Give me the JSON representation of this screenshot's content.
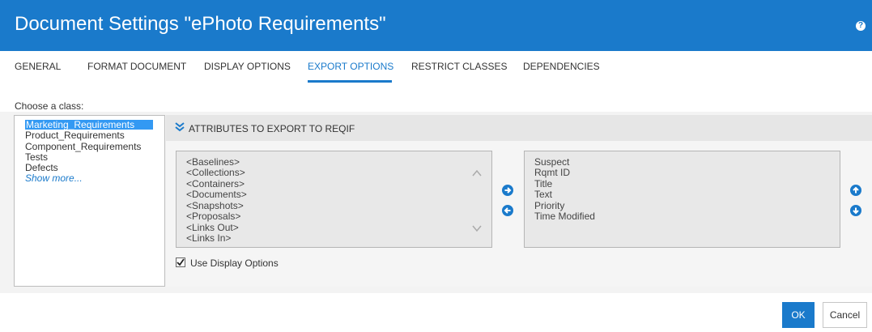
{
  "header": {
    "title": "Document Settings \"ePhoto Requirements\"",
    "help_icon": "question-circle-icon",
    "help_glyph": "?"
  },
  "tabs": [
    {
      "label": "GENERAL"
    },
    {
      "label": "FORMAT DOCUMENT"
    },
    {
      "label": "DISPLAY OPTIONS"
    },
    {
      "label": "EXPORT OPTIONS",
      "active": true
    },
    {
      "label": "RESTRICT CLASSES"
    },
    {
      "label": "DEPENDENCIES"
    }
  ],
  "class_panel": {
    "label": "Choose a class:",
    "items": [
      {
        "label": "Marketing_Requirements",
        "selected": true
      },
      {
        "label": "Product_Requirements"
      },
      {
        "label": "Component_Requirements"
      },
      {
        "label": "Tests"
      },
      {
        "label": "Defects"
      }
    ],
    "show_more": "Show more..."
  },
  "attributes": {
    "header": "ATTRIBUTES TO EXPORT TO REQIF",
    "available": [
      "<Baselines>",
      "<Collections>",
      "<Containers>",
      "<Documents>",
      "<Snapshots>",
      "<Proposals>",
      "<Links Out>",
      "<Links In>"
    ],
    "selected": [
      "Suspect",
      "Rqmt ID",
      "Title",
      "Text",
      "Priority",
      "Time Modified"
    ],
    "use_display_options": {
      "label": "Use Display Options",
      "checked": true
    }
  },
  "footer": {
    "ok_label": "OK",
    "cancel_label": "Cancel"
  },
  "colors": {
    "accent": "#1a7acb",
    "selection": "#3399f3"
  }
}
